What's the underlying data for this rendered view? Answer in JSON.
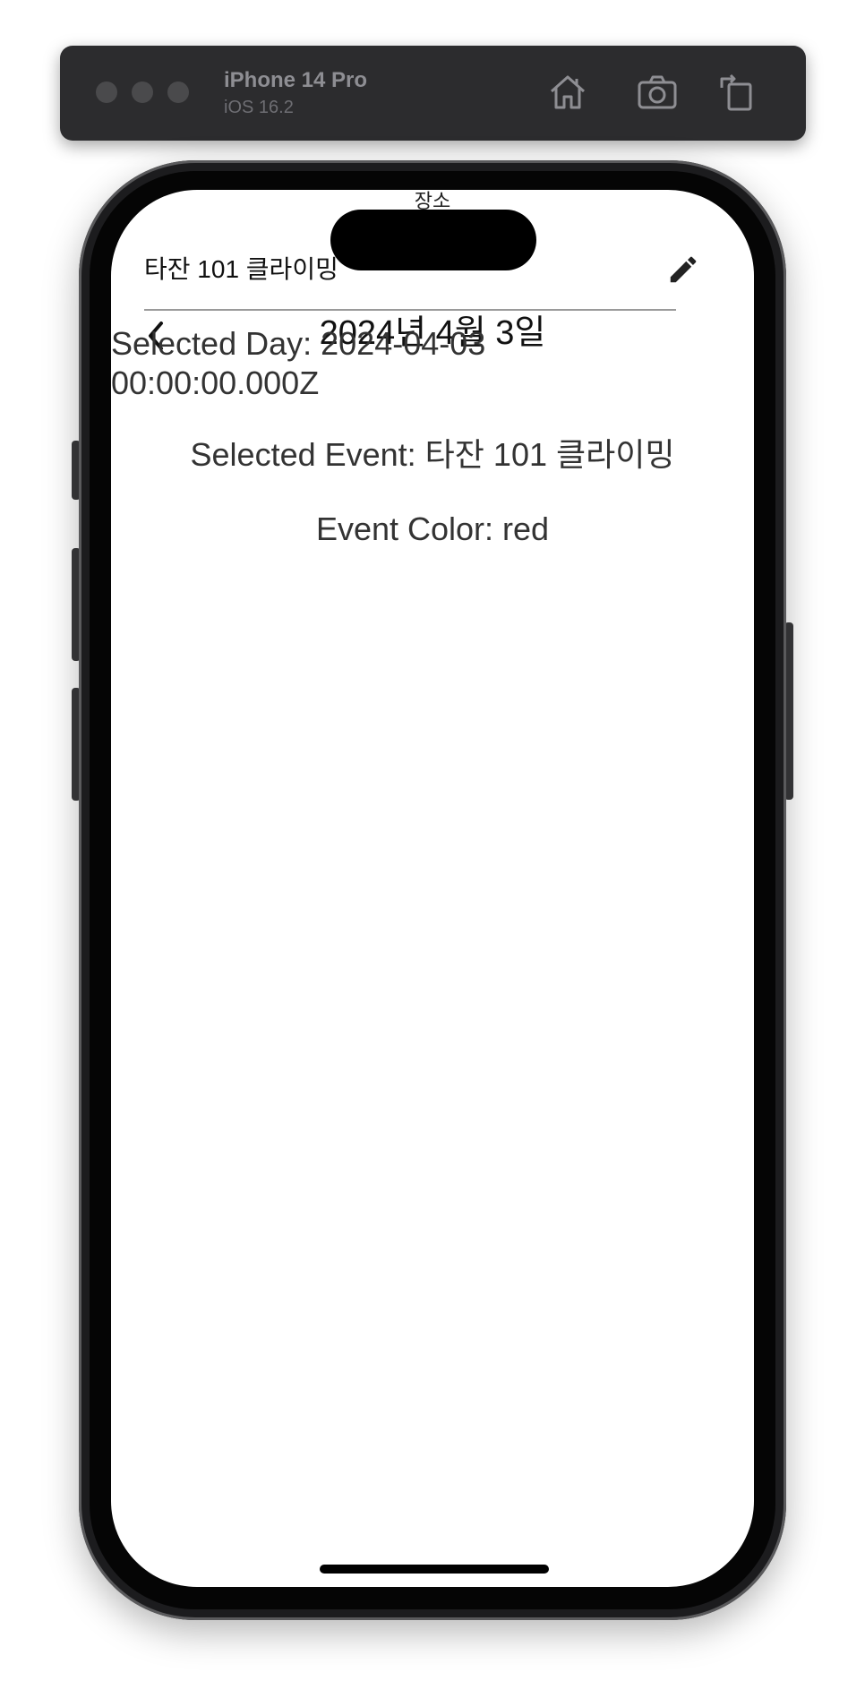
{
  "simulator": {
    "device_name": "iPhone 14 Pro",
    "os_version": "iOS 16.2",
    "icons": [
      "home-icon",
      "screenshot-icon",
      "rotate-icon"
    ]
  },
  "app": {
    "place_label": "장소",
    "event_title": "타잔 101 클라이밍",
    "nav_date": "2024년 4월 3일",
    "selected_day": "Selected Day: 2024-04-03 00:00:00.000Z",
    "selected_event": "Selected Event: 타잔 101 클라이밍",
    "event_color": "Event Color: red"
  },
  "colors": {
    "toolbar_bg": "#2c2c2e",
    "text_primary": "#111111",
    "text_secondary": "#333333"
  }
}
